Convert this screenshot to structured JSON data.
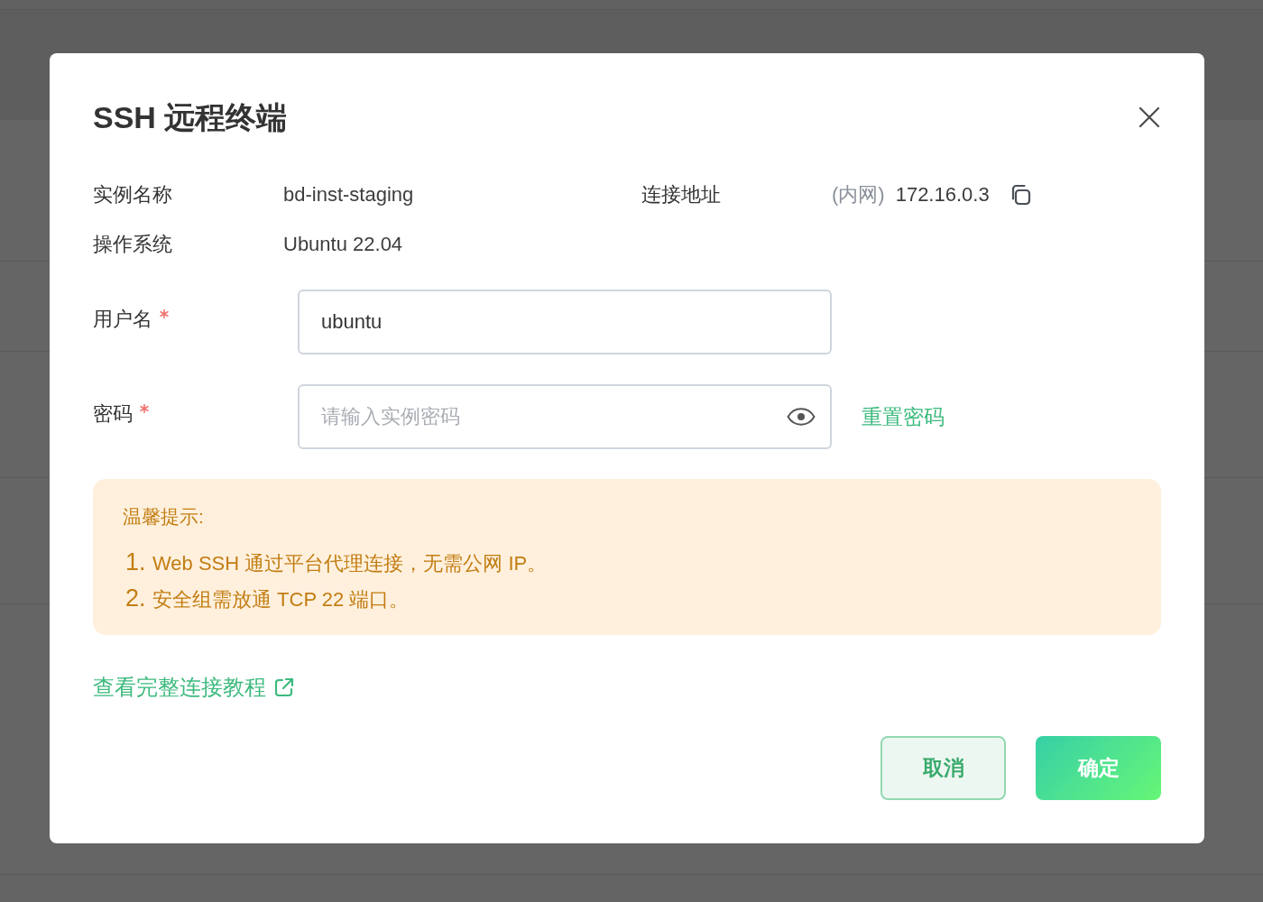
{
  "dialog": {
    "title": "SSH 远程终端"
  },
  "info": [
    {
      "kind": "text",
      "label": "实例名称",
      "value": "bd-inst-staging"
    },
    {
      "kind": "address",
      "label": "连接地址",
      "tag": "(内网)",
      "value": "172.16.0.3"
    },
    {
      "kind": "text",
      "label": "操作系统",
      "value": "Ubuntu 22.04"
    }
  ],
  "fields": [
    {
      "kind": "text",
      "label": "用户名",
      "required": true,
      "value": "ubuntu"
    },
    {
      "kind": "password",
      "label": "密码",
      "required": true,
      "placeholder": "请输入实例密码",
      "action": "重置密码"
    }
  ],
  "tip": {
    "title": "温馨提示:",
    "items": [
      {
        "number": "1.",
        "text": "Web SSH 通过平台代理连接，无需公网 IP。"
      },
      {
        "number": "2.",
        "text": "安全组需放通 TCP 22 端口。"
      }
    ]
  },
  "link": {
    "text": "查看完整连接教程"
  },
  "buttons": [
    {
      "kind": "secondary",
      "label": "取消"
    },
    {
      "kind": "primary",
      "label": "确定"
    }
  ]
}
